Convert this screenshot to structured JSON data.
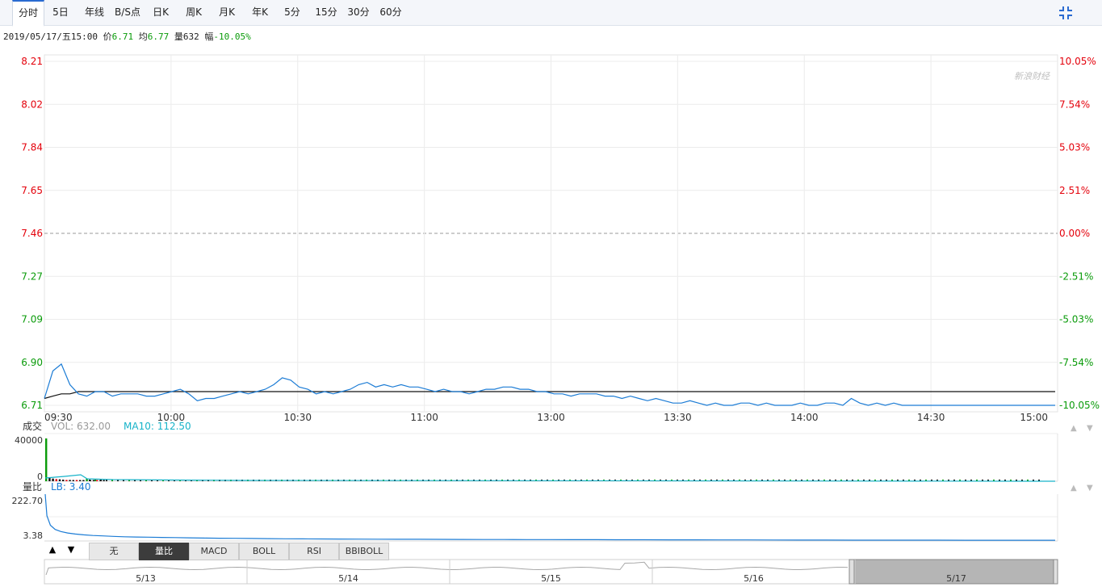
{
  "tabs": [
    {
      "label": "分时",
      "active": true
    },
    {
      "label": "5日"
    },
    {
      "label": "年线"
    },
    {
      "label": "B/S点"
    },
    {
      "label": "日K"
    },
    {
      "label": "周K"
    },
    {
      "label": "月K"
    },
    {
      "label": "年K"
    },
    {
      "label": "5分"
    },
    {
      "label": "15分"
    },
    {
      "label": "30分"
    },
    {
      "label": "60分"
    }
  ],
  "info": {
    "datetime": "2019/05/17/五15:00",
    "price_label": "价",
    "price": "6.71",
    "avg_label": "均",
    "avg": "6.77",
    "vol_label": "量",
    "vol": "632",
    "chg_label": "幅",
    "chg": "-10.05%"
  },
  "colors": {
    "up": "#e4010b",
    "down": "#0a9b0a",
    "price_line": "#1c7cd5",
    "avg_line": "#111111",
    "grid": "#ececec",
    "volume_line": "#17b3c9"
  },
  "watermark": "新浪财经",
  "chart_data": [
    {
      "type": "line",
      "name": "price",
      "left_ticks": [
        "8.21",
        "8.02",
        "7.84",
        "7.65",
        "7.46",
        "7.27",
        "7.09",
        "6.90",
        "6.71"
      ],
      "right_ticks": [
        "10.05%",
        "7.54%",
        "5.03%",
        "2.51%",
        "0.00%",
        "-2.51%",
        "-5.03%",
        "-7.54%",
        "-10.05%"
      ],
      "x_ticks": [
        "09:30",
        "10:00",
        "10:30",
        "11:00",
        "13:00",
        "13:30",
        "14:00",
        "14:30",
        "15:00"
      ],
      "ylim": [
        6.71,
        8.21
      ],
      "prev_close": 7.46,
      "series": [
        {
          "values": [
            6.74,
            6.86,
            6.89,
            6.8,
            6.76,
            6.75,
            6.77,
            6.77,
            6.75,
            6.76,
            6.76,
            6.76,
            6.75,
            6.75,
            6.76,
            6.77,
            6.78,
            6.76,
            6.73,
            6.74,
            6.74,
            6.75,
            6.76,
            6.77,
            6.76,
            6.77,
            6.78,
            6.8,
            6.83,
            6.82,
            6.79,
            6.78,
            6.76,
            6.77,
            6.76,
            6.77,
            6.78,
            6.8,
            6.81,
            6.79,
            6.8,
            6.79,
            6.8,
            6.79,
            6.79,
            6.78,
            6.77,
            6.78,
            6.77,
            6.77,
            6.76,
            6.77,
            6.78,
            6.78,
            6.79,
            6.79,
            6.78,
            6.78,
            6.77,
            6.77,
            6.76,
            6.76,
            6.75,
            6.76,
            6.76,
            6.76,
            6.75,
            6.75,
            6.74,
            6.75,
            6.74,
            6.73,
            6.74,
            6.73,
            6.72,
            6.72,
            6.73,
            6.72,
            6.71,
            6.72,
            6.71,
            6.71,
            6.72,
            6.72,
            6.71,
            6.72,
            6.71,
            6.71,
            6.71,
            6.72,
            6.71,
            6.71,
            6.72,
            6.72,
            6.71,
            6.74,
            6.72,
            6.71,
            6.72,
            6.71,
            6.72,
            6.71,
            6.71,
            6.71,
            6.71,
            6.71,
            6.71,
            6.71,
            6.71,
            6.71,
            6.71,
            6.71,
            6.71,
            6.71,
            6.71,
            6.71,
            6.71,
            6.71,
            6.71,
            6.71
          ]
        },
        {
          "values": [
            6.74,
            6.75,
            6.76,
            6.76,
            6.77,
            6.77,
            6.77,
            6.77,
            6.77,
            6.77,
            6.77,
            6.77,
            6.77,
            6.77,
            6.77,
            6.77,
            6.77,
            6.77,
            6.77,
            6.77,
            6.77,
            6.77,
            6.77,
            6.77,
            6.77,
            6.77,
            6.77,
            6.77,
            6.77,
            6.77,
            6.77,
            6.77,
            6.77,
            6.77,
            6.77,
            6.77,
            6.77,
            6.77,
            6.77,
            6.77,
            6.77,
            6.77,
            6.77,
            6.77,
            6.77,
            6.77,
            6.77,
            6.77,
            6.77,
            6.77,
            6.77,
            6.77,
            6.77,
            6.77,
            6.77,
            6.77,
            6.77,
            6.77,
            6.77,
            6.77,
            6.77,
            6.77,
            6.77,
            6.77,
            6.77,
            6.77,
            6.77,
            6.77,
            6.77,
            6.77,
            6.77,
            6.77,
            6.77,
            6.77,
            6.77,
            6.77,
            6.77,
            6.77,
            6.77,
            6.77,
            6.77,
            6.77,
            6.77,
            6.77,
            6.77,
            6.77,
            6.77,
            6.77,
            6.77,
            6.77,
            6.77,
            6.77,
            6.77,
            6.77,
            6.77,
            6.77,
            6.77,
            6.77,
            6.77,
            6.77,
            6.77,
            6.77,
            6.77,
            6.77,
            6.77,
            6.77,
            6.77,
            6.77,
            6.77,
            6.77,
            6.77,
            6.77,
            6.77,
            6.77,
            6.77,
            6.77,
            6.77,
            6.77,
            6.77,
            6.77
          ]
        }
      ]
    },
    {
      "type": "bar",
      "name": "volume",
      "label": "成交",
      "vol_legend": "VOL: 632.00",
      "ma_legend": "MA10: 112.50",
      "y_ticks": [
        "40000",
        "0"
      ],
      "ylim": [
        0,
        40000
      ],
      "values": [
        40000,
        3000,
        2500,
        2000,
        1800,
        1500,
        1200,
        1200,
        1000,
        900,
        800,
        700,
        2500,
        600,
        500,
        400,
        400,
        300
      ]
    },
    {
      "type": "line",
      "name": "volume-ratio",
      "label": "量比",
      "lb_legend": "LB: 3.40",
      "y_ticks": [
        "222.70",
        "3.38"
      ],
      "ylim": [
        0,
        222.7
      ],
      "values": [
        222.7,
        120,
        75,
        55,
        45,
        38,
        33,
        29,
        26,
        24,
        22,
        20,
        19,
        18,
        17,
        16,
        15,
        14,
        13,
        12.5,
        12,
        11,
        10.5,
        10,
        9.6,
        9.2,
        8.8,
        8.5,
        8.2,
        7.9,
        7.6,
        7.3,
        7.0,
        6.8,
        6.6,
        6.4,
        6.2,
        6.0,
        5.8,
        5.6,
        5.4,
        5.2,
        5.0,
        4.8,
        4.6,
        4.4,
        4.2,
        4.0,
        3.9,
        3.8,
        3.7,
        3.6,
        3.5,
        3.45,
        3.4
      ]
    }
  ],
  "indicator_tabs": [
    {
      "label": "无"
    },
    {
      "label": "量比",
      "active": true
    },
    {
      "label": "MACD"
    },
    {
      "label": "BOLL"
    },
    {
      "label": "RSI"
    },
    {
      "label": "BBIBOLL"
    }
  ],
  "arrows": {
    "up": "▲",
    "down": "▼"
  },
  "navigator": {
    "dates": [
      "5/13",
      "5/14",
      "5/15",
      "5/16",
      "5/17"
    ]
  }
}
